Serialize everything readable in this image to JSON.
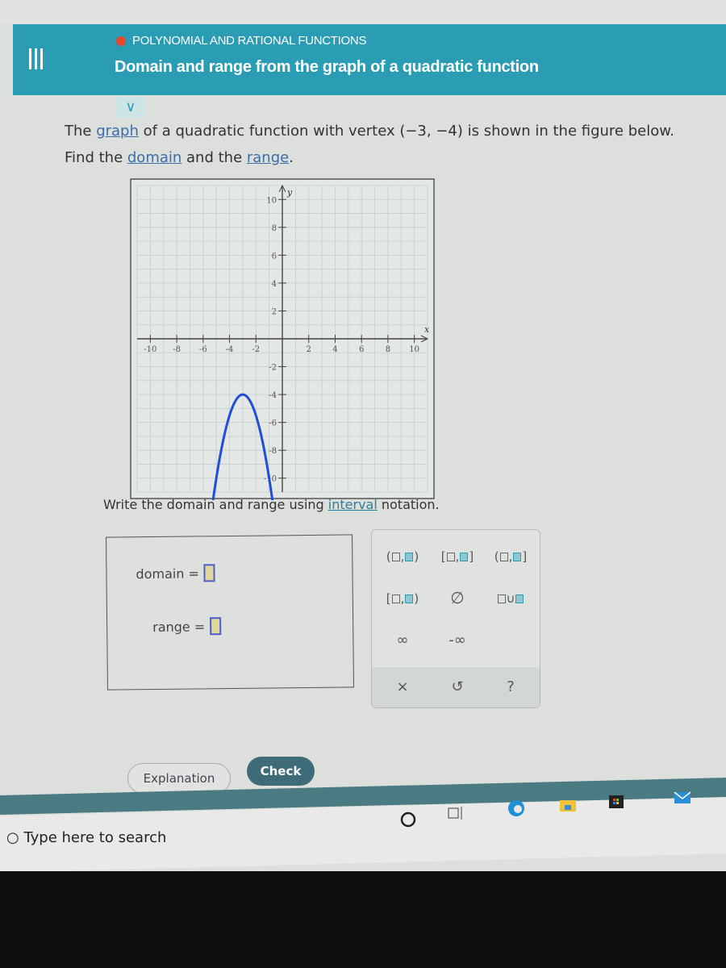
{
  "header": {
    "section": "POLYNOMIAL AND RATIONAL FUNCTIONS",
    "title": "Domain and range from the graph of a quadratic function",
    "section_dot_color": "#e3492c",
    "bg_color": "#2a9db5"
  },
  "question": {
    "line1_pre": "The ",
    "line1_link": "graph",
    "line1_post": " of a quadratic function with vertex ",
    "vertex": "(−3, −4)",
    "line1_end": " is shown in the figure below.",
    "line2_pre": "Find the ",
    "line2_link1": "domain",
    "line2_mid": " and the ",
    "line2_link2": "range",
    "line2_end": "."
  },
  "chart_data": {
    "type": "line",
    "title": "",
    "xlabel": "x",
    "ylabel": "y",
    "xlim": [
      -11,
      11
    ],
    "ylim": [
      -11,
      11
    ],
    "x_ticks": [
      -10,
      -8,
      -6,
      -4,
      -2,
      2,
      4,
      6,
      8,
      10
    ],
    "y_ticks": [
      10,
      8,
      6,
      4,
      2,
      -2,
      -4,
      -6,
      -8,
      -10
    ],
    "x_tick_labels": [
      "-10",
      "-8",
      "-6",
      "-4",
      "-2",
      "2",
      "4",
      "6",
      "8",
      "10"
    ],
    "y_tick_labels": [
      "10",
      "8",
      "6",
      "4",
      "2",
      "-2",
      "-4",
      "-6",
      "-8",
      "-10"
    ],
    "grid": true,
    "series": [
      {
        "name": "parabola",
        "color": "#1f4fd8",
        "vertex": [
          -3,
          -4
        ],
        "a": -1.5,
        "x_range": [
          -5.4,
          -0.6
        ],
        "arrows_at_ends": true
      }
    ]
  },
  "instruction": {
    "pre": "Write the domain and range using ",
    "link": "interval",
    "post": " notation."
  },
  "answer": {
    "domain_label": "domain =",
    "range_label": "range =",
    "domain_value": "",
    "range_value": ""
  },
  "keypad": {
    "keys": [
      "(□,□)",
      "[□,□]",
      "(□,□]",
      "[□,□)",
      "∅",
      "□∪□",
      "∞",
      "-∞"
    ],
    "clear": "×",
    "undo": "↺",
    "help": "?"
  },
  "buttons": {
    "explanation": "Explanation",
    "check": "Check"
  },
  "taskbar": {
    "search_placeholder": "Type here to search"
  }
}
